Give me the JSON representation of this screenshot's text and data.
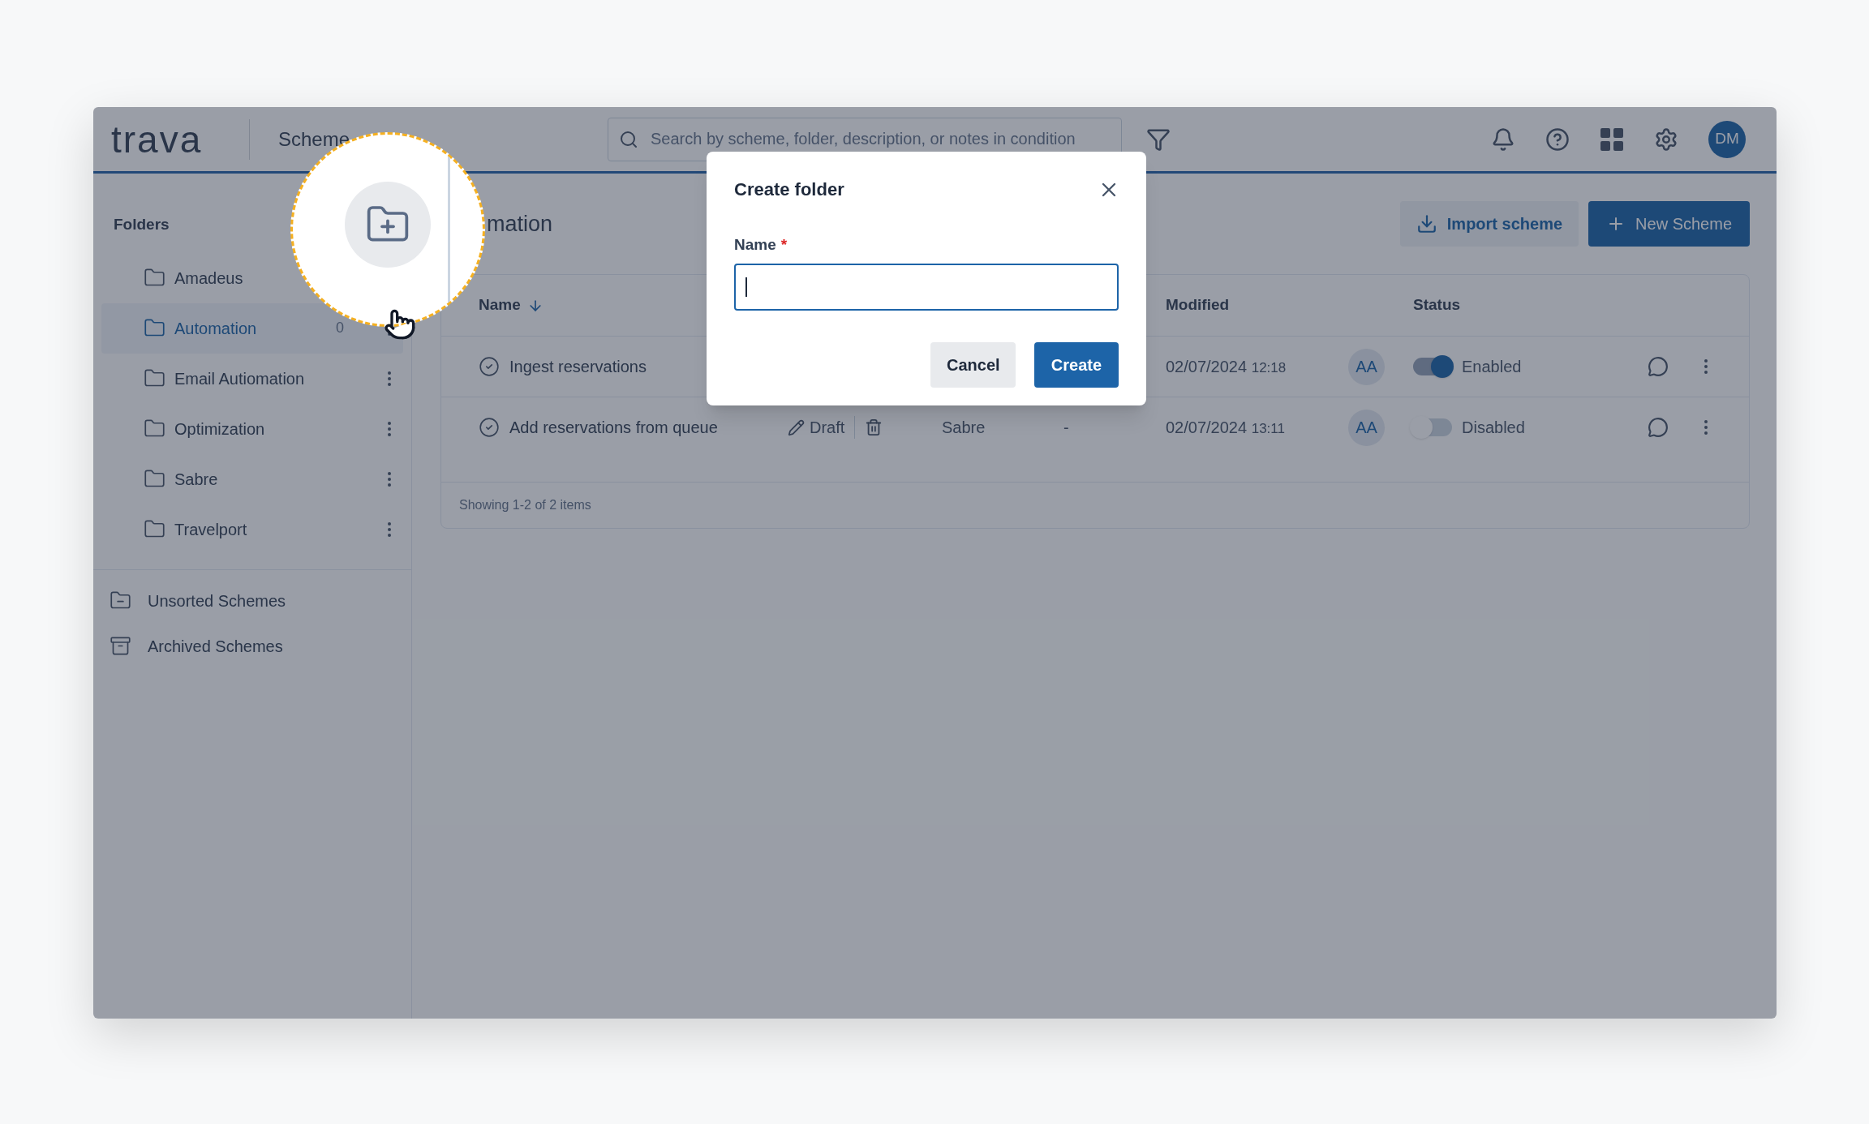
{
  "header": {
    "logo": "trava",
    "title": "Scheme",
    "search": {
      "placeholder": "Search by scheme, folder, description, or notes in condition"
    },
    "avatar": "DM"
  },
  "sidebar": {
    "heading": "Folders",
    "folders": [
      {
        "name": "Amadeus",
        "selected": false
      },
      {
        "name": "Automation",
        "selected": true,
        "count": "0"
      },
      {
        "name": "Email Autiomation",
        "selected": false
      },
      {
        "name": "Optimization",
        "selected": false
      },
      {
        "name": "Sabre",
        "selected": false
      },
      {
        "name": "Travelport",
        "selected": false
      }
    ],
    "links": [
      {
        "kind": "unsorted",
        "label": "Unsorted Schemes"
      },
      {
        "kind": "archived",
        "label": "Archived Schemes"
      }
    ]
  },
  "main": {
    "title": "mation",
    "buttons": [
      {
        "kind": "import",
        "label": "Import scheme"
      },
      {
        "kind": "new",
        "label": "New Scheme"
      }
    ],
    "table": {
      "columns": [
        {
          "kind": "name",
          "label": "Name",
          "sorted": true
        },
        {
          "kind": "modified",
          "label": "Modified",
          "sorted": false
        },
        {
          "kind": "status",
          "label": "Status",
          "sorted": false
        }
      ],
      "rows": [
        {
          "name": "Ingest reservations",
          "modified_date": "02/07/2024",
          "modified_time": "12:18",
          "author": "AA",
          "on": true,
          "status": "Enabled"
        },
        {
          "name": "Add reservations from queue",
          "draft": "Draft",
          "source": "Sabre",
          "column_4": "-",
          "modified_date": "02/07/2024",
          "modified_time": "13:11",
          "author": "AA",
          "on": false,
          "status": "Disabled"
        }
      ],
      "footer": "Showing 1-2 of 2 items"
    }
  },
  "dialog": {
    "title": "Create folder",
    "field": {
      "label": "Name",
      "required_mark": "*"
    },
    "buttons": [
      {
        "kind": "secondary",
        "label": "Cancel"
      },
      {
        "kind": "primary",
        "label": "Create"
      }
    ]
  }
}
